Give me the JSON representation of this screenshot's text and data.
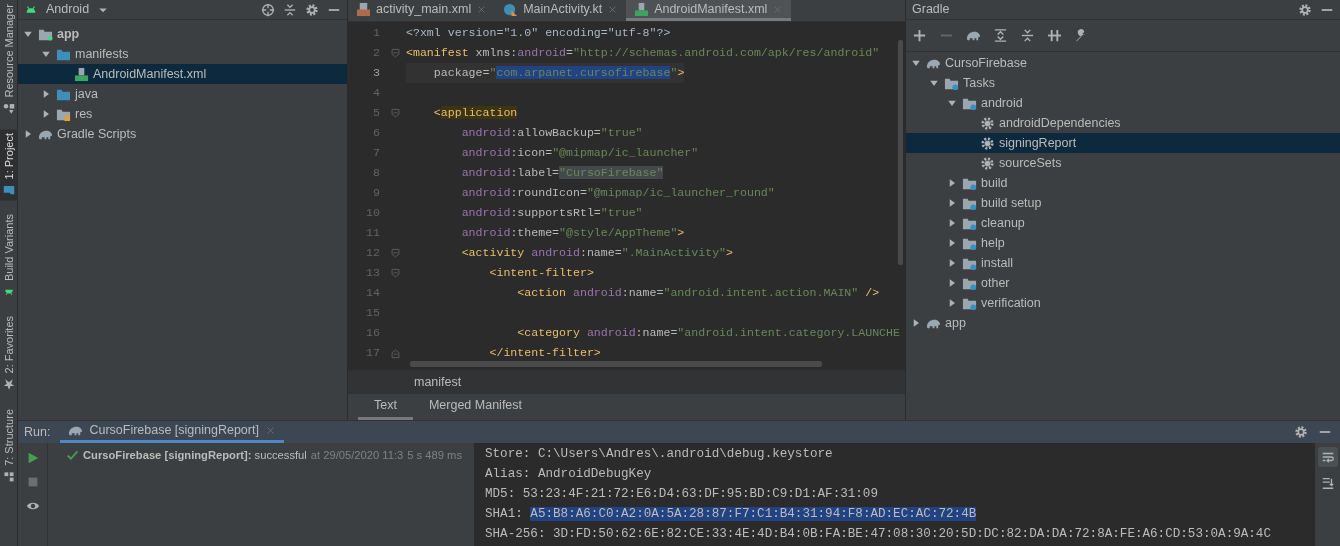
{
  "left_stripe": [
    {
      "label": "Resource Manager",
      "selected": false,
      "kind": "resources"
    },
    {
      "label": "1: Project",
      "selected": true,
      "kind": "folder"
    },
    {
      "label": "Build Variants",
      "selected": false,
      "kind": "android"
    },
    {
      "label": "2: Favorites",
      "selected": false,
      "kind": "star"
    },
    {
      "label": "7: Structure",
      "selected": false,
      "kind": "structure"
    }
  ],
  "project": {
    "view": "Android",
    "tree": [
      {
        "label": "app",
        "kind": "module",
        "bold": true,
        "expanded": true,
        "selected": false,
        "children": [
          {
            "label": "manifests",
            "kind": "folder",
            "expanded": true,
            "selected": false,
            "children": [
              {
                "label": "AndroidManifest.xml",
                "kind": "manifest",
                "selected": true
              }
            ]
          },
          {
            "label": "java",
            "kind": "folder",
            "expanded": false,
            "selected": false
          },
          {
            "label": "res",
            "kind": "res",
            "expanded": false,
            "selected": false
          }
        ]
      },
      {
        "label": "Gradle Scripts",
        "kind": "gradle",
        "expanded": false,
        "selected": false
      }
    ]
  },
  "editor": {
    "tabs": [
      {
        "label": "activity_main.xml",
        "kind": "layout",
        "selected": false
      },
      {
        "label": "MainActivity.kt",
        "kind": "kotlin",
        "selected": false
      },
      {
        "label": "AndroidManifest.xml",
        "kind": "manifest",
        "selected": true
      }
    ],
    "lines": [
      {
        "number": "1",
        "current": false,
        "segments": [
          {
            "text": "<?xml version=\"1.0\" encoding=\"utf-8\"?>",
            "kind": "plain"
          }
        ]
      },
      {
        "number": "2",
        "current": false,
        "kind": "fold-start",
        "segments": [
          {
            "text": "<manifest",
            "kind": "tag"
          },
          {
            "text": " xmlns:",
            "kind": "attr"
          },
          {
            "text": "android",
            "kind": "ns"
          },
          {
            "text": "=",
            "kind": "attr"
          },
          {
            "text": "\"http://schemas.android.com/apk/res/android\"",
            "kind": "value"
          }
        ]
      },
      {
        "number": "3",
        "current": true,
        "segments": [
          {
            "text": "    package=",
            "kind": "attr"
          },
          {
            "text": "\"",
            "kind": "value"
          },
          {
            "text": "com.arpanet.cursofirebase",
            "kind": "value",
            "selected": true
          },
          {
            "text": "\"",
            "kind": "value"
          },
          {
            "text": ">",
            "kind": "tag"
          }
        ]
      },
      {
        "number": "4",
        "current": false
      },
      {
        "number": "5",
        "current": false,
        "kind": "fold-start",
        "segments": [
          {
            "text": "    <",
            "kind": "tag"
          },
          {
            "text": "application",
            "kind": "tag",
            "highlighted": true
          }
        ]
      },
      {
        "number": "6",
        "current": false,
        "segments": [
          {
            "text": "        android",
            "kind": "ns"
          },
          {
            "text": ":allowBackup=",
            "kind": "attr"
          },
          {
            "text": "\"true\"",
            "kind": "value"
          }
        ]
      },
      {
        "number": "7",
        "current": false,
        "segments": [
          {
            "text": "        android",
            "kind": "ns"
          },
          {
            "text": ":icon=",
            "kind": "attr"
          },
          {
            "text": "\"@mipmap/ic_launcher\"",
            "kind": "value"
          }
        ]
      },
      {
        "number": "8",
        "current": false,
        "segments": [
          {
            "text": "        android",
            "kind": "ns"
          },
          {
            "text": ":label=",
            "kind": "attr"
          },
          {
            "text": "\"CursoFirebase\"",
            "kind": "value",
            "highlighted": true
          }
        ]
      },
      {
        "number": "9",
        "current": false,
        "segments": [
          {
            "text": "        android",
            "kind": "ns"
          },
          {
            "text": ":roundIcon=",
            "kind": "attr"
          },
          {
            "text": "\"@mipmap/ic_launcher_round\"",
            "kind": "value"
          }
        ]
      },
      {
        "number": "10",
        "current": false,
        "segments": [
          {
            "text": "        android",
            "kind": "ns"
          },
          {
            "text": ":supportsRtl=",
            "kind": "attr"
          },
          {
            "text": "\"true\"",
            "kind": "value"
          }
        ]
      },
      {
        "number": "11",
        "current": false,
        "segments": [
          {
            "text": "        android",
            "kind": "ns"
          },
          {
            "text": ":theme=",
            "kind": "attr"
          },
          {
            "text": "\"@style/AppTheme\"",
            "kind": "value"
          },
          {
            "text": ">",
            "kind": "tag"
          }
        ]
      },
      {
        "number": "12",
        "current": false,
        "kind": "fold-start",
        "segments": [
          {
            "text": "        <activity",
            "kind": "tag"
          },
          {
            "text": " android",
            "kind": "ns"
          },
          {
            "text": ":name=",
            "kind": "attr"
          },
          {
            "text": "\".MainActivity\"",
            "kind": "value"
          },
          {
            "text": ">",
            "kind": "tag"
          }
        ]
      },
      {
        "number": "13",
        "current": false,
        "kind": "fold-start",
        "segments": [
          {
            "text": "            <intent-filter>",
            "kind": "tag"
          }
        ]
      },
      {
        "number": "14",
        "current": false,
        "segments": [
          {
            "text": "                <action",
            "kind": "tag"
          },
          {
            "text": " android",
            "kind": "ns"
          },
          {
            "text": ":name=",
            "kind": "attr"
          },
          {
            "text": "\"android.intent.action.MAIN\"",
            "kind": "value"
          },
          {
            "text": " />",
            "kind": "tag"
          }
        ]
      },
      {
        "number": "15",
        "current": false
      },
      {
        "number": "16",
        "current": false,
        "segments": [
          {
            "text": "                <category",
            "kind": "tag"
          },
          {
            "text": " android",
            "kind": "ns"
          },
          {
            "text": ":name=",
            "kind": "attr"
          },
          {
            "text": "\"android.intent.category.LAUNCHE",
            "kind": "value"
          }
        ]
      },
      {
        "number": "17",
        "current": false,
        "kind": "fold-end",
        "segments": [
          {
            "text": "            </intent-filter>",
            "kind": "tag"
          }
        ]
      }
    ],
    "breadcrumb": "manifest",
    "bottom_tabs": [
      {
        "label": "Text",
        "selected": true
      },
      {
        "label": "Merged Manifest",
        "selected": false
      }
    ]
  },
  "gradle": {
    "title": "Gradle",
    "toolbar": [
      {
        "kind": "plus",
        "disabled": false
      },
      {
        "kind": "minus",
        "disabled": true
      },
      {
        "kind": "elephant",
        "disabled": false
      },
      {
        "kind": "expand",
        "disabled": false
      },
      {
        "kind": "collapse",
        "disabled": false
      },
      {
        "kind": "offline",
        "disabled": false
      },
      {
        "kind": "wrench",
        "disabled": false
      }
    ],
    "tree": [
      {
        "label": "CursoFirebase",
        "kind": "project",
        "expanded": true,
        "selected": false,
        "children": [
          {
            "label": "Tasks",
            "kind": "taskfolder",
            "expanded": true,
            "selected": false,
            "children": [
              {
                "label": "android",
                "kind": "taskfolder",
                "expanded": true,
                "selected": false,
                "children": [
                  {
                    "label": "androidDependencies",
                    "kind": "task",
                    "selected": false
                  },
                  {
                    "label": "signingReport",
                    "kind": "task",
                    "selected": true
                  },
                  {
                    "label": "sourceSets",
                    "kind": "task",
                    "selected": false
                  }
                ]
              },
              {
                "label": "build",
                "kind": "taskfolder",
                "expanded": false,
                "selected": false
              },
              {
                "label": "build setup",
                "kind": "taskfolder",
                "expanded": false,
                "selected": false
              },
              {
                "label": "cleanup",
                "kind": "taskfolder",
                "expanded": false,
                "selected": false
              },
              {
                "label": "help",
                "kind": "taskfolder",
                "expanded": false,
                "selected": false
              },
              {
                "label": "install",
                "kind": "taskfolder",
                "expanded": false,
                "selected": false
              },
              {
                "label": "other",
                "kind": "taskfolder",
                "expanded": false,
                "selected": false
              },
              {
                "label": "verification",
                "kind": "taskfolder",
                "expanded": false,
                "selected": false
              }
            ]
          }
        ]
      },
      {
        "label": "app",
        "kind": "project",
        "expanded": false,
        "selected": false
      }
    ]
  },
  "run": {
    "label": "Run:",
    "tabs": [
      {
        "label": "CursoFirebase [signingReport]",
        "selected": true
      }
    ],
    "result": {
      "text": "**CursoFirebase [signingReport]:** successful",
      "time": "at 29/05/2020 11:3",
      "duration": "5 s 489 ms",
      "success": true
    },
    "soft_wrap": true,
    "console": [
      [
        {
          "text": "Store: C:\\Users\\Andres\\.android\\debug.keystore",
          "selected": false
        }
      ],
      [
        {
          "text": "Alias: AndroidDebugKey",
          "selected": false
        }
      ],
      [
        {
          "text": "MD5: 53:23:4F:21:72:E6:D4:63:DF:95:BD:C9:D1:AF:31:09",
          "selected": false
        }
      ],
      [
        {
          "text": "SHA1: ",
          "selected": false
        },
        {
          "text": "A5:B8:A6:C0:A2:0A:5A:28:87:F7:C1:B4:31:94:F8:AD:EC:AC:72:4B",
          "selected": true
        }
      ],
      [
        {
          "text": "SHA-256: 3D:FD:50:62:6E:82:CE:33:4E:4D:B4:0B:FA:BE:47:08:30:20:5D:DC:82:DA:DA:72:8A:FE:A6:CD:53:0A:9A:4C",
          "selected": false
        }
      ]
    ]
  }
}
